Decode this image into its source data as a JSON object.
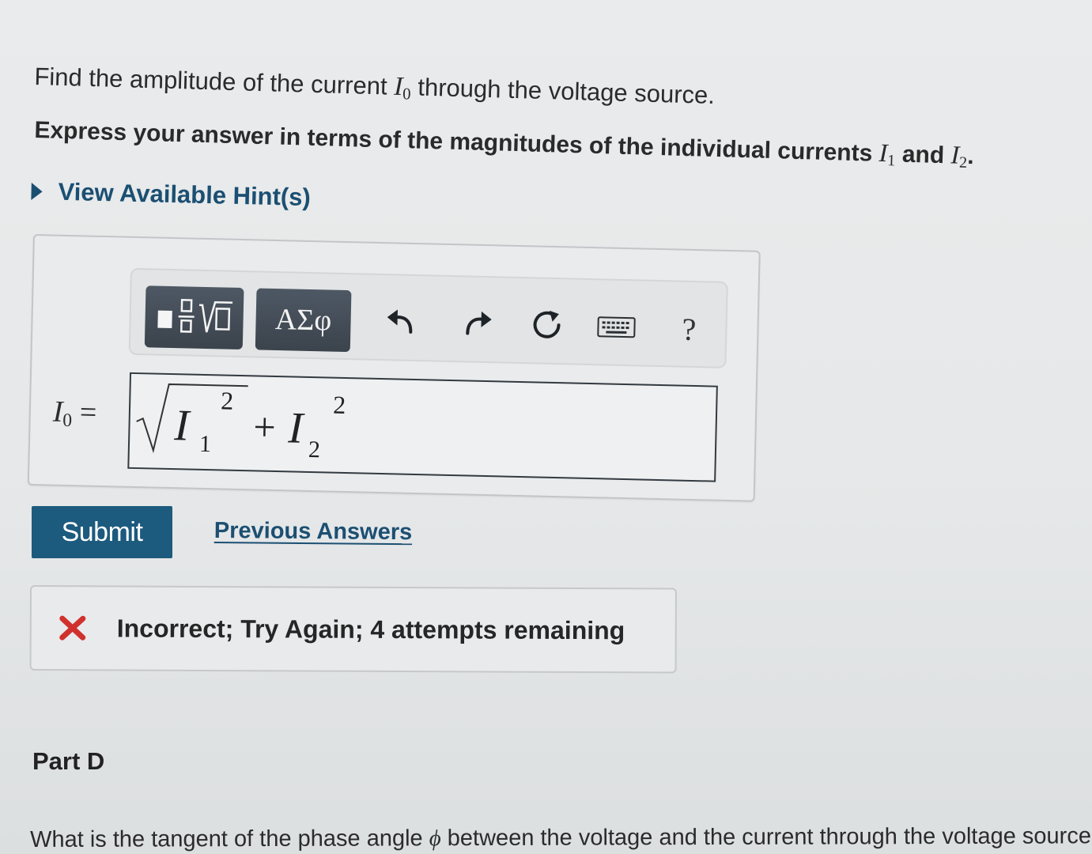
{
  "question": {
    "prefix": "Find the amplitude of the current",
    "var": "I",
    "var_sub": "0",
    "suffix": "through the voltage source."
  },
  "instruction": {
    "prefix": "Express your answer in terms of the magnitudes of the individual currents",
    "var1": "I",
    "var1_sub": "1",
    "middle": "and",
    "var2": "I",
    "var2_sub": "2",
    "suffix": "."
  },
  "hints": {
    "label": "View Available Hint(s)"
  },
  "toolbar": {
    "greek_label": "ΑΣφ",
    "help_label": "?",
    "icons": [
      "templates-icon",
      "greek-symbols-icon",
      "undo-icon",
      "redo-icon",
      "reset-icon",
      "keyboard-icon",
      "help-icon"
    ]
  },
  "answer": {
    "label_var": "I",
    "label_sub": "0",
    "label_eq": "=",
    "expression": {
      "var1": "I",
      "sub1": "1",
      "exp1": "2",
      "op": "+",
      "var2": "I",
      "sub2": "2",
      "exp2": "2"
    }
  },
  "submit": {
    "label": "Submit"
  },
  "previous_answers": {
    "label": "Previous Answers"
  },
  "feedback": {
    "status": "incorrect",
    "text": "Incorrect; Try Again; 4 attempts remaining",
    "color": "#d0312d"
  },
  "part_d": {
    "title": "Part D"
  },
  "next_question": {
    "prefix": "What is the tangent of the phase angle",
    "symbol": "ϕ",
    "suffix": "between the voltage and the current through the voltage source"
  },
  "colors": {
    "link": "#1b4f72",
    "submit_bg": "#1c5a7e",
    "toolbar_button": "#444d57",
    "error": "#d0312d"
  }
}
